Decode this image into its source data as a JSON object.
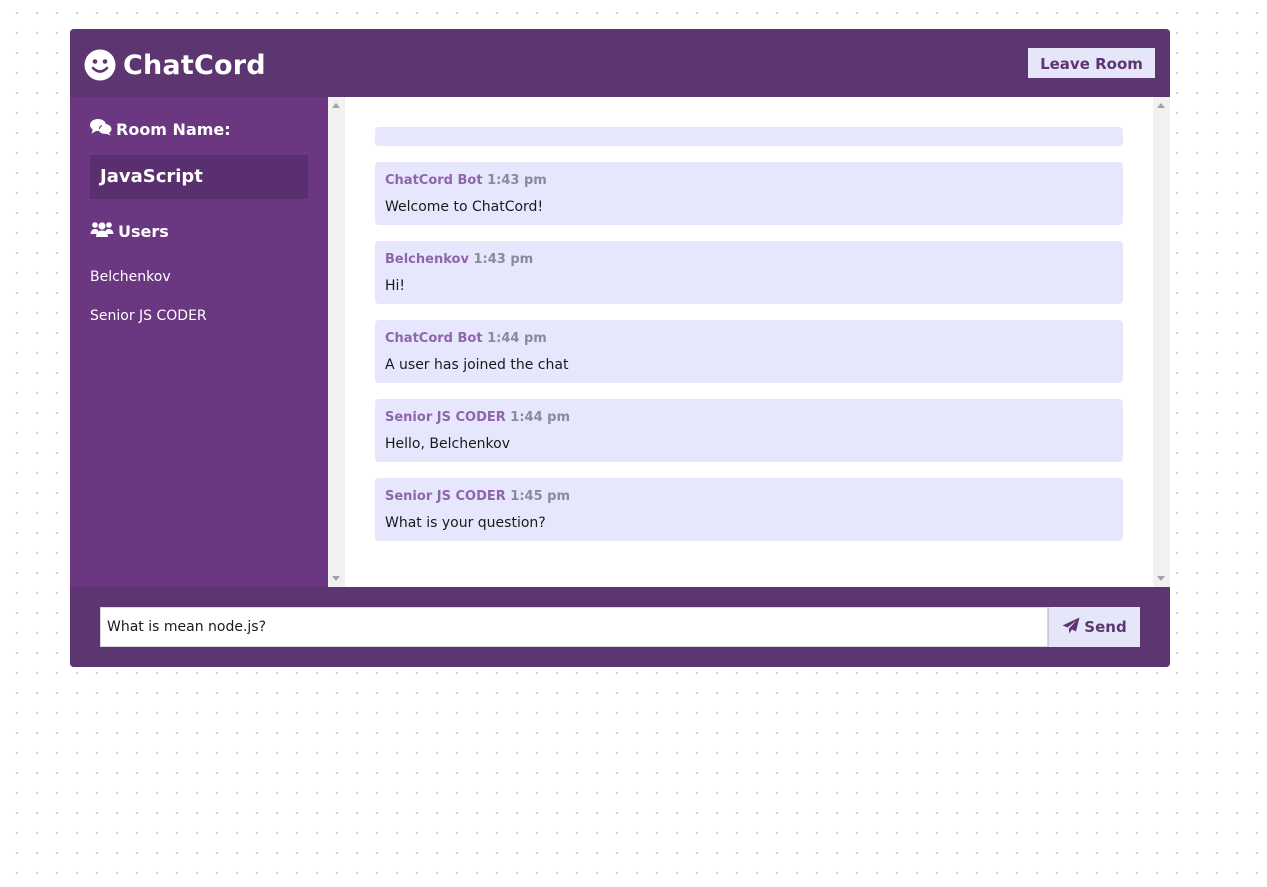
{
  "app": {
    "title": "ChatCord",
    "leave_label": "Leave Room"
  },
  "sidebar": {
    "room_heading": "Room Name:",
    "room_name": "JavaScript",
    "users_heading": "Users",
    "users": [
      "Belchenkov",
      "Senior JS CODER"
    ]
  },
  "messages": [
    {
      "username": "ChatCord Bot",
      "time": "1:43 pm",
      "text": "Welcome to ChatCord!"
    },
    {
      "username": "Belchenkov",
      "time": "1:43 pm",
      "text": "Hi!"
    },
    {
      "username": "ChatCord Bot",
      "time": "1:44 pm",
      "text": "A user has joined the chat"
    },
    {
      "username": "Senior JS CODER",
      "time": "1:44 pm",
      "text": "Hello, Belchenkov"
    },
    {
      "username": "Senior JS CODER",
      "time": "1:45 pm",
      "text": "What is your question?"
    }
  ],
  "form": {
    "input_value": "What is mean node.js?",
    "send_label": "Send"
  },
  "icons": {
    "logo": "smile-icon",
    "room": "comments-icon",
    "users": "users-icon",
    "send": "paper-plane-icon"
  },
  "colors": {
    "header": "#5d3570",
    "sidebar": "#6a3780",
    "accent": "#e6e6fa",
    "message_bg": "#e6e7fd",
    "username": "#9065ac"
  }
}
